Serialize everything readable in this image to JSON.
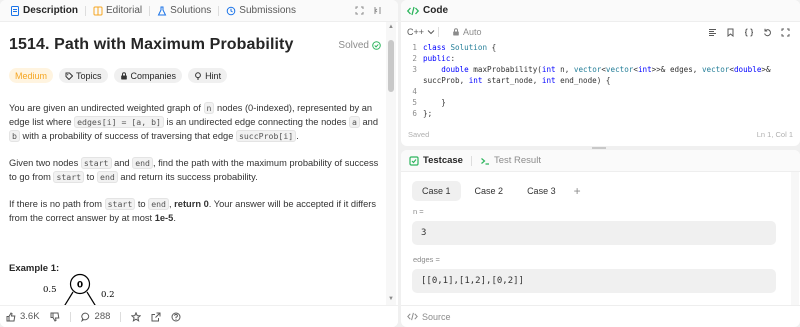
{
  "left": {
    "tabs": [
      {
        "label": "Description",
        "color": "#1a73e8"
      },
      {
        "label": "Editorial",
        "color": "#f5a623"
      },
      {
        "label": "Solutions",
        "color": "#1a73e8"
      },
      {
        "label": "Submissions",
        "color": "#1a73e8"
      }
    ],
    "problem": {
      "title": "1514. Path with Maximum Probability",
      "status": "Solved",
      "status_color": "#2db55d",
      "chips": {
        "difficulty": "Medium",
        "topics": "Topics",
        "companies": "Companies",
        "hint": "Hint"
      },
      "p1": {
        "a": "You are given an undirected weighted graph of ",
        "c1": "n",
        "b": " nodes (0-indexed), represented by an edge list where ",
        "c2": "edges[i] = [a, b]",
        "c": " is an undirected edge connecting the nodes ",
        "c3": "a",
        "d": " and ",
        "c4": "b",
        "e": " with a probability of success of traversing that edge ",
        "c5": "succProb[i]",
        "f": "."
      },
      "p2": {
        "a": "Given two nodes ",
        "c1": "start",
        "b": " and ",
        "c2": "end",
        "c": ", find the path with the maximum probability of success to go from ",
        "c3": "start",
        "d": " to ",
        "c4": "end",
        "e": " and return its success probability."
      },
      "p3": {
        "a": "If there is no path from ",
        "c1": "start",
        "b": " to ",
        "c2": "end",
        "c": ", ",
        "bold1": "return 0",
        "d": ". Your answer will be accepted if it differs from the correct answer by at most ",
        "bold2": "1e-5",
        "e": "."
      },
      "example_heading": "Example 1:",
      "graph": {
        "node": "0",
        "left_edge": "0.5",
        "right_edge": "0.2"
      }
    },
    "bottom": {
      "likes": "3.6K",
      "comments": "288"
    }
  },
  "code": {
    "title": "Code",
    "language": "C++",
    "mode": "Auto",
    "lines": [
      {
        "n": "1",
        "segments": [
          {
            "t": "class",
            "k": "kw"
          },
          {
            "t": " "
          },
          {
            "t": "Solution",
            "k": "ty"
          },
          {
            "t": " {"
          }
        ]
      },
      {
        "n": "2",
        "segments": [
          {
            "t": "public",
            "k": "kw"
          },
          {
            "t": ":"
          }
        ]
      },
      {
        "n": "3",
        "segments": [
          {
            "t": "    "
          },
          {
            "t": "double",
            "k": "kw"
          },
          {
            "t": " maxProbability("
          },
          {
            "t": "int",
            "k": "kw"
          },
          {
            "t": " n, "
          },
          {
            "t": "vector",
            "k": "ty"
          },
          {
            "t": "<"
          },
          {
            "t": "vector",
            "k": "ty"
          },
          {
            "t": "<"
          },
          {
            "t": "int",
            "k": "kw"
          },
          {
            "t": ">>& edges, "
          },
          {
            "t": "vector",
            "k": "ty"
          },
          {
            "t": "<"
          },
          {
            "t": "double",
            "k": "kw"
          },
          {
            "t": ">&"
          }
        ]
      },
      {
        "n": "",
        "segments": [
          {
            "t": "succProb, "
          },
          {
            "t": "int",
            "k": "kw"
          },
          {
            "t": " start_node, "
          },
          {
            "t": "int",
            "k": "kw"
          },
          {
            "t": " end_node) {"
          }
        ]
      },
      {
        "n": "4",
        "segments": [
          {
            "t": "        "
          }
        ]
      },
      {
        "n": "5",
        "segments": [
          {
            "t": "    }"
          }
        ]
      },
      {
        "n": "6",
        "segments": [
          {
            "t": "};"
          }
        ]
      }
    ],
    "saved_label": "Saved",
    "cursor_pos": "Ln 1, Col 1"
  },
  "testcase": {
    "tab_label": "Testcase",
    "result_label": "Test Result",
    "cases": [
      "Case 1",
      "Case 2",
      "Case 3"
    ],
    "fields": [
      {
        "label": "n =",
        "value": "3"
      },
      {
        "label": "edges =",
        "value": "[[0,1],[1,2],[0,2]]"
      }
    ],
    "source_label": "Source"
  },
  "colors": {
    "accent_green": "#2db55d",
    "accent_blue": "#1a73e8",
    "medium": "#f5a623",
    "keyword": "#0000ff",
    "type": "#267f99"
  }
}
